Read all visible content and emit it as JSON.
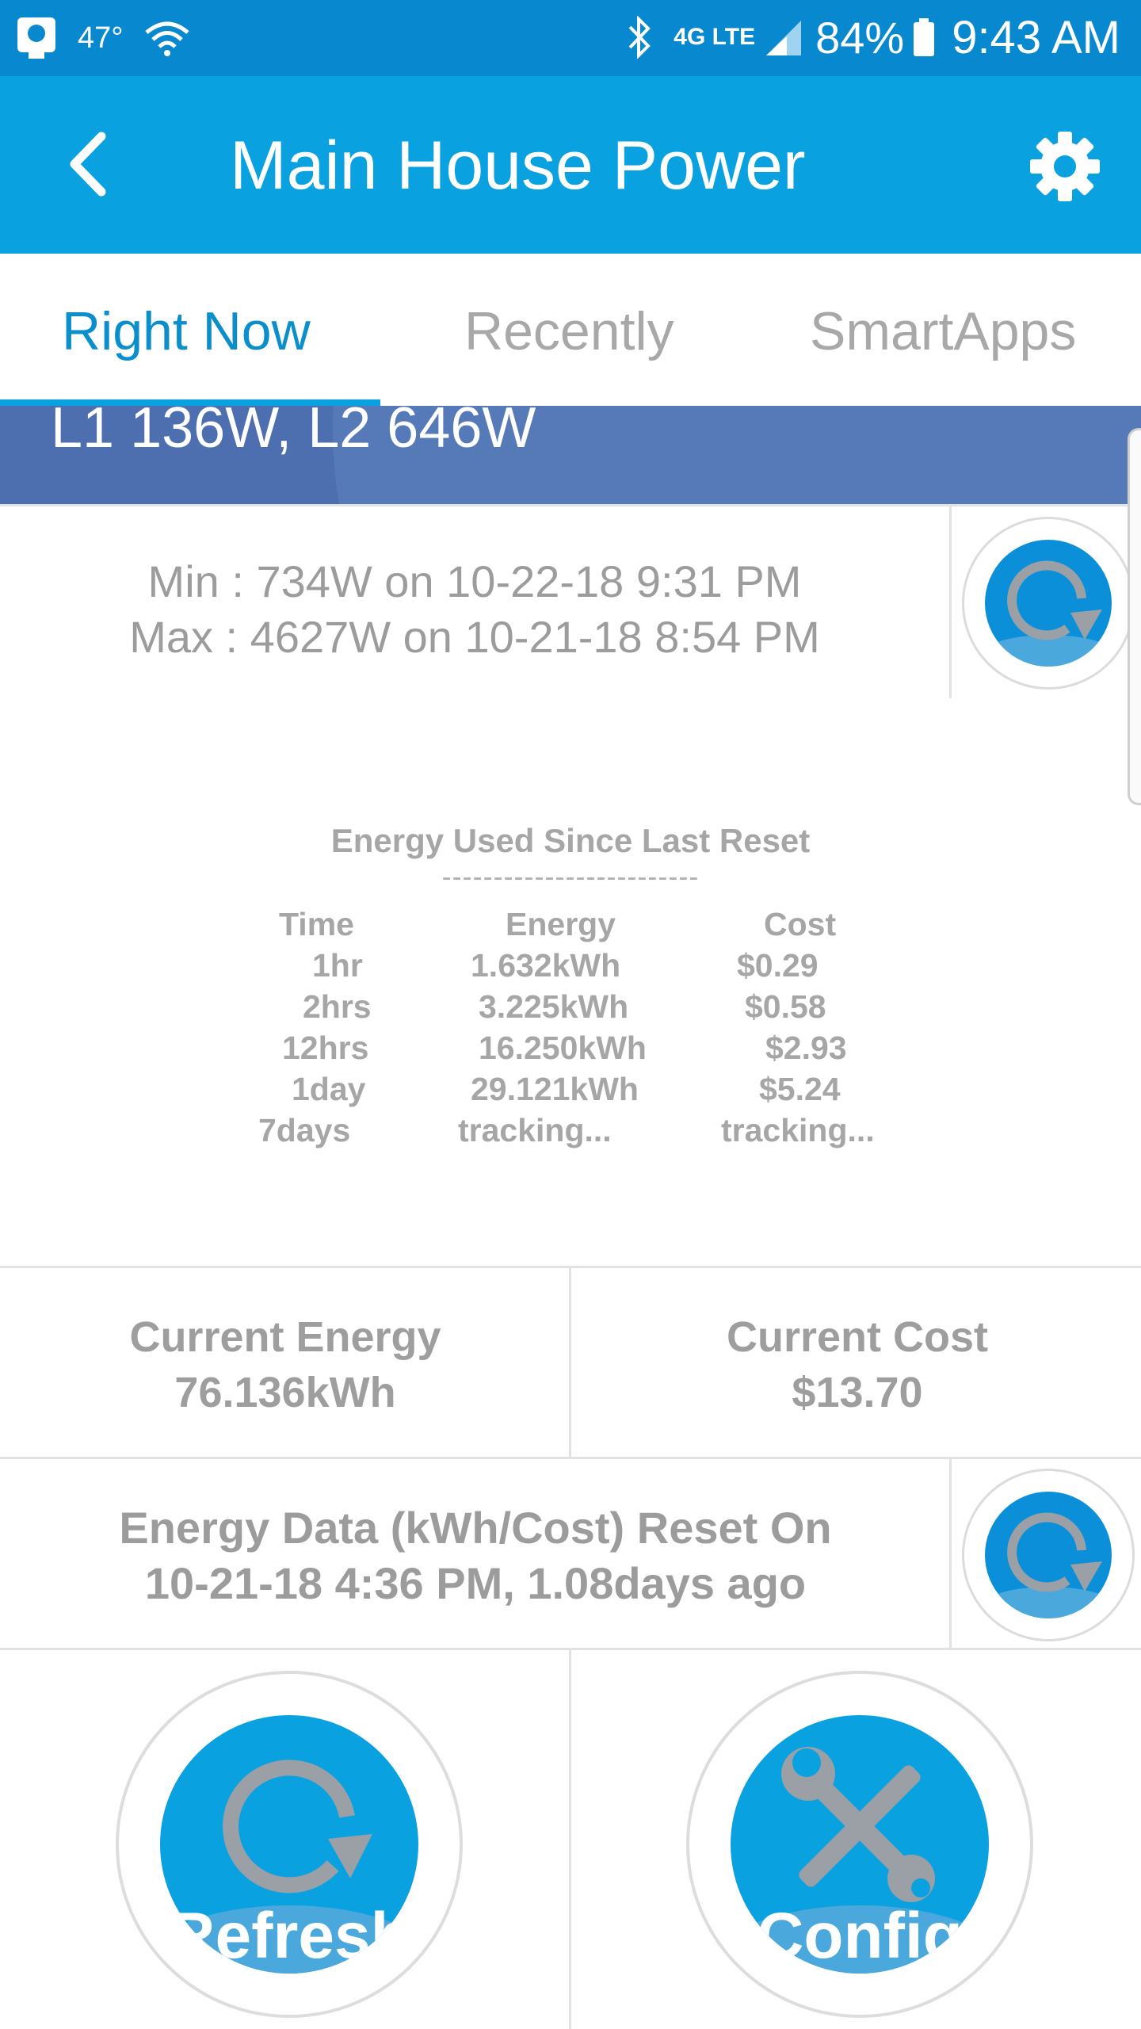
{
  "status_bar": {
    "temperature": "47°",
    "network": "4G LTE",
    "battery": "84%",
    "time": "9:43 AM",
    "icons": [
      "weather-icon",
      "wifi-icon",
      "bluetooth-icon",
      "signal-icon",
      "battery-icon"
    ]
  },
  "app_bar": {
    "title": "Main House Power",
    "back_icon": "chevron-left-icon",
    "settings_icon": "gear-icon"
  },
  "tabs": [
    {
      "label": "Right Now",
      "active": true
    },
    {
      "label": "Recently",
      "active": false
    },
    {
      "label": "SmartApps",
      "active": false
    }
  ],
  "banner": {
    "text": "L1  136W, L2 646W"
  },
  "min_max": {
    "min": "Min : 734W on 10-22-18 9:31 PM",
    "max": "Max : 4627W on 10-21-18 8:54 PM"
  },
  "energy_block": {
    "title": "Energy Used Since Last Reset",
    "divider": "-------------------------",
    "headers": [
      "Time",
      "Energy",
      "Cost"
    ],
    "rows": [
      [
        "1hr",
        "1.632kWh",
        "$0.29"
      ],
      [
        "2hrs",
        "3.225kWh",
        "$0.58"
      ],
      [
        "12hrs",
        "16.250kWh",
        "$2.93"
      ],
      [
        "1day",
        "29.121kWh",
        "$5.24"
      ],
      [
        "7days",
        "tracking...",
        "tracking..."
      ]
    ]
  },
  "current": {
    "energy_label": "Current Energy",
    "energy_value": "76.136kWh",
    "cost_label": "Current Cost",
    "cost_value": "$13.70"
  },
  "reset": {
    "line1": "Energy Data (kWh/Cost) Reset On",
    "line2": "10-21-18 4:36 PM, 1.08days ago"
  },
  "buttons": {
    "refresh_label": "Refresh",
    "config_label": "Config"
  },
  "colors": {
    "status_bar": "#0888cf",
    "app_bar": "#0aa1e0",
    "active_tab": "#0a8fcc",
    "banner": "#4d6fb0",
    "button_fill": "#0aa1e0",
    "text_gray": "#9c9c9c"
  }
}
